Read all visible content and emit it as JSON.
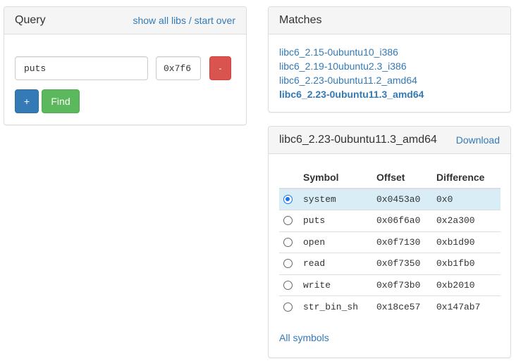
{
  "query": {
    "title": "Query",
    "show_all_libs": "show all libs",
    "separator": "/",
    "start_over": "start over",
    "symbol_value": "puts",
    "address_value": "0x7f6",
    "remove_label": "-",
    "add_label": "+",
    "find_label": "Find"
  },
  "matches": {
    "title": "Matches",
    "items": [
      {
        "label": "libc6_2.15-0ubuntu10_i386"
      },
      {
        "label": "libc6_2.19-10ubuntu2.3_i386"
      },
      {
        "label": "libc6_2.23-0ubuntu11.2_amd64"
      },
      {
        "label": "libc6_2.23-0ubuntu11.3_amd64"
      }
    ]
  },
  "details": {
    "title": "libc6_2.23-0ubuntu11.3_amd64",
    "download_label": "Download",
    "headers": {
      "symbol": "Symbol",
      "offset": "Offset",
      "difference": "Difference"
    },
    "rows": [
      {
        "symbol": "system",
        "offset": "0x0453a0",
        "difference": "0x0"
      },
      {
        "symbol": "puts",
        "offset": "0x06f6a0",
        "difference": "0x2a300"
      },
      {
        "symbol": "open",
        "offset": "0x0f7130",
        "difference": "0xb1d90"
      },
      {
        "symbol": "read",
        "offset": "0x0f7350",
        "difference": "0xb1fb0"
      },
      {
        "symbol": "write",
        "offset": "0x0f73b0",
        "difference": "0xb2010"
      },
      {
        "symbol": "str_bin_sh",
        "offset": "0x18ce57",
        "difference": "0x147ab7"
      }
    ],
    "all_symbols_label": "All symbols"
  },
  "colors": {
    "link": "#337ab7",
    "danger": "#d9534f",
    "primary": "#337ab7",
    "success": "#5cb85c",
    "selected_row": "#d9edf7"
  }
}
